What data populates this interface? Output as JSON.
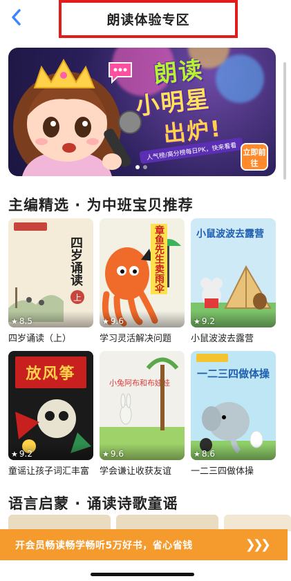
{
  "header": {
    "title": "朗读体验专区",
    "back_icon": "chevron-left-icon",
    "accent": "#3a86ff"
  },
  "banner": {
    "line1": "朗读",
    "line2": "小明星",
    "line3": "出炉!",
    "ribbon": "人气榜/高分榜每日PK，快来看看",
    "cta": "立即前往",
    "page_count": 2,
    "active_page": 1
  },
  "section1": {
    "title": "主编精选 · 为中班宝贝推荐",
    "books": [
      {
        "title": "四岁诵读（上）",
        "rating": "8.5",
        "cover_text": "四岁诵读",
        "badge": "上"
      },
      {
        "title": "学习灵活解决问题",
        "rating": "9.6",
        "cover_text": "章鱼先生卖雨伞"
      },
      {
        "title": "小鼠波波去露营",
        "rating": "9.2",
        "cover_text": "小鼠波波去露营"
      },
      {
        "title": "童谣让孩子词汇丰富",
        "rating": "9.2",
        "cover_text": "放风筝"
      },
      {
        "title": "学会谦让收获友谊",
        "rating": "9.6",
        "cover_text": "小兔阿布和布娃娃"
      },
      {
        "title": "一二三四做体操",
        "rating": "8.6",
        "cover_text": "一二三四做体操"
      }
    ]
  },
  "section2": {
    "title": "语言启蒙 · 诵读诗歌童谣"
  },
  "promo": {
    "text": "开会员畅读畅学畅听5万好书，省心省钱",
    "arrows": "❯❯❯"
  },
  "colors": {
    "promo_bg": "#f59a2d",
    "header_border": "#e21b1b"
  }
}
